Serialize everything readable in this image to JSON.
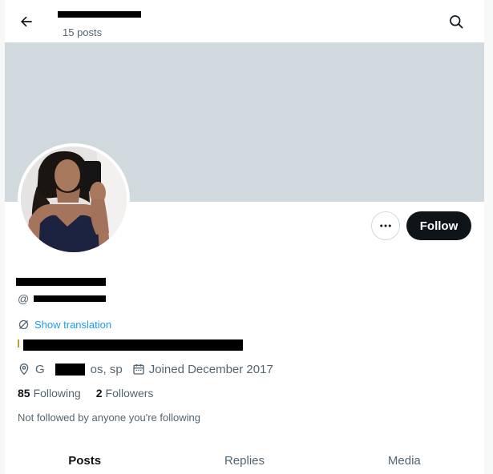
{
  "header": {
    "posts_count": "15 posts",
    "back_icon": "arrow-left-icon",
    "search_icon": "search-icon"
  },
  "colors": {
    "banner": "#cfd9de",
    "accent_link": "#1d9bf0",
    "follow_button": "#0f1419",
    "secondary_text": "#536471"
  },
  "profile": {
    "handle_prefix": "@",
    "show_translation": "Show translation",
    "location_start": "G",
    "location_end": "os, sp",
    "joined": "Joined December 2017",
    "following_count": "85",
    "following_label": "Following",
    "followers_count": "2",
    "followers_label": "Followers",
    "not_followed_text": "Not followed by anyone you're following"
  },
  "actions": {
    "follow_label": "Follow",
    "more_icon": "more-horizontal-icon"
  },
  "tabs": [
    {
      "label": "Posts",
      "active": true
    },
    {
      "label": "Replies",
      "active": false
    },
    {
      "label": "Media",
      "active": false
    }
  ]
}
